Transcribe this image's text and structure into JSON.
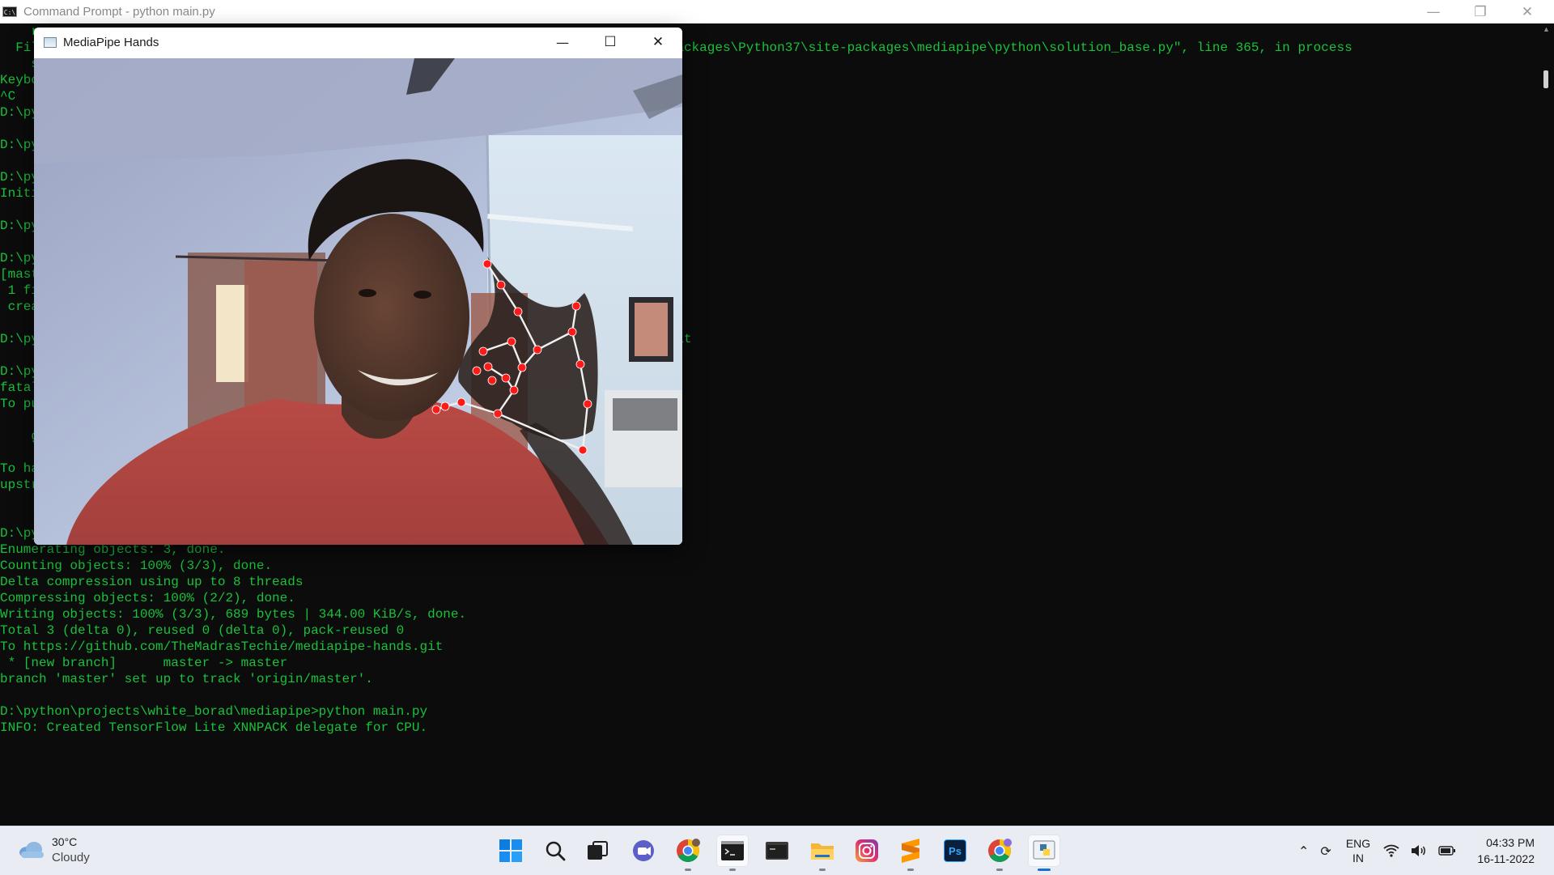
{
  "cmd": {
    "title": "Command Prompt - python  main.py",
    "icon_text": "C:\\",
    "controls": {
      "minimize": "—",
      "restore": "❐",
      "close": "✕"
    }
  },
  "console_lines": [
    "    r",
    "  Fil                                                             p0\\LocalCache\\local-packages\\Python37\\site-packages\\mediapipe\\python\\solution_base.py\", line 365, in process",
    "    s",
    "Keybo",
    "^C",
    "D:\\py",
    "",
    "D:\\py",
    "",
    "D:\\py",
    "Initi",
    "",
    "D:\\py",
    "",
    "D:\\py",
    "[mast",
    " 1 fi",
    " crea",
    "",
    "D:\\py                                                             hie/mediapipe-hands.git",
    "",
    "D:\\py",
    "fatal",
    "To pu",
    "",
    "    g",
    "",
    "To ha",
    "upstr",
    "",
    "",
    "D:\\py",
    "Enumerating objects: 3, done.",
    "Counting objects: 100% (3/3), done.",
    "Delta compression using up to 8 threads",
    "Compressing objects: 100% (2/2), done.",
    "Writing objects: 100% (3/3), 689 bytes | 344.00 KiB/s, done.",
    "Total 3 (delta 0), reused 0 (delta 0), pack-reused 0",
    "To https://github.com/TheMadrasTechie/mediapipe-hands.git",
    " * [new branch]      master -> master",
    "branch 'master' set up to track 'origin/master'.",
    "",
    "D:\\python\\projects\\white_borad\\mediapipe>python main.py",
    "INFO: Created TensorFlow Lite XNNPACK delegate for CPU."
  ],
  "mediapipe": {
    "title": "MediaPipe Hands",
    "controls": {
      "minimize": "—",
      "maximize": "☐",
      "close": "✕"
    }
  },
  "colors": {
    "terminal_bg": "#0c0c0c",
    "terminal_text": "#19c23a",
    "landmark": "#ff1a1a",
    "connection": "#f0f0f0",
    "shirt": "#b3403c",
    "taskbar_bg": "#e9edf3"
  },
  "taskbar": {
    "weather": {
      "temp": "30°C",
      "condition": "Cloudy",
      "icon": "cloud-icon"
    },
    "apps": [
      {
        "name": "start-button",
        "icon": "windows-logo-icon"
      },
      {
        "name": "search-button",
        "icon": "search-icon"
      },
      {
        "name": "task-view-button",
        "icon": "task-view-icon"
      },
      {
        "name": "teams-chat-button",
        "icon": "chat-icon"
      },
      {
        "name": "chrome-app",
        "icon": "chrome-icon"
      },
      {
        "name": "command-prompt-app",
        "icon": "terminal-icon"
      },
      {
        "name": "terminal-app",
        "icon": "console-icon"
      },
      {
        "name": "file-explorer-app",
        "icon": "folder-icon"
      },
      {
        "name": "instagram-app",
        "icon": "instagram-icon"
      },
      {
        "name": "sublime-text-app",
        "icon": "sublime-icon"
      },
      {
        "name": "photoshop-app",
        "icon": "photoshop-icon"
      },
      {
        "name": "chrome-profile-app",
        "icon": "chrome-icon"
      },
      {
        "name": "python-app",
        "icon": "python-icon"
      }
    ],
    "photoshop_label": "Ps",
    "tray": {
      "lang_1": "ENG",
      "lang_2": "IN"
    },
    "clock": {
      "time": "04:33 PM",
      "date": "16-11-2022"
    }
  }
}
